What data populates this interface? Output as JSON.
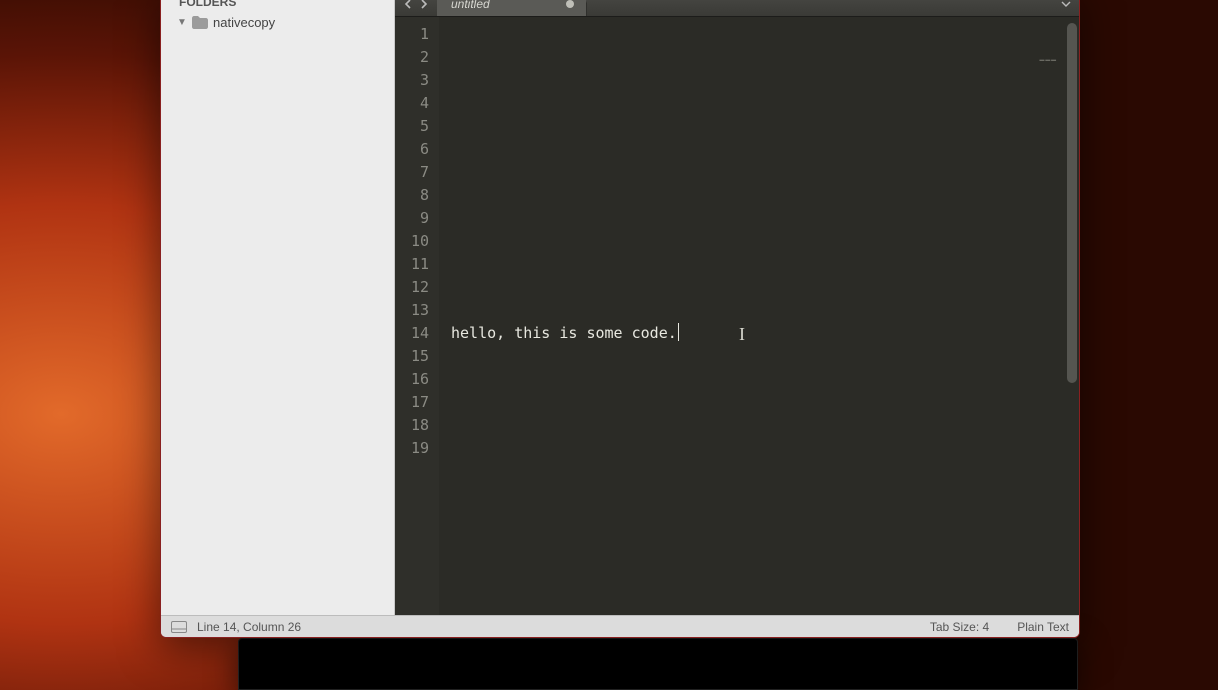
{
  "sidebar": {
    "header": "FOLDERS",
    "items": [
      {
        "name": "nativecopy"
      }
    ]
  },
  "tabs": [
    {
      "title": "untitled",
      "dirty": true
    }
  ],
  "editor": {
    "total_lines": 19,
    "content_line_index": 14,
    "content_text": "hello, this is some code.",
    "cursor_line": 14,
    "cursor_col": 26
  },
  "status": {
    "position": "Line 14, Column 26",
    "tab_size": "Tab Size: 4",
    "syntax": "Plain Text"
  }
}
